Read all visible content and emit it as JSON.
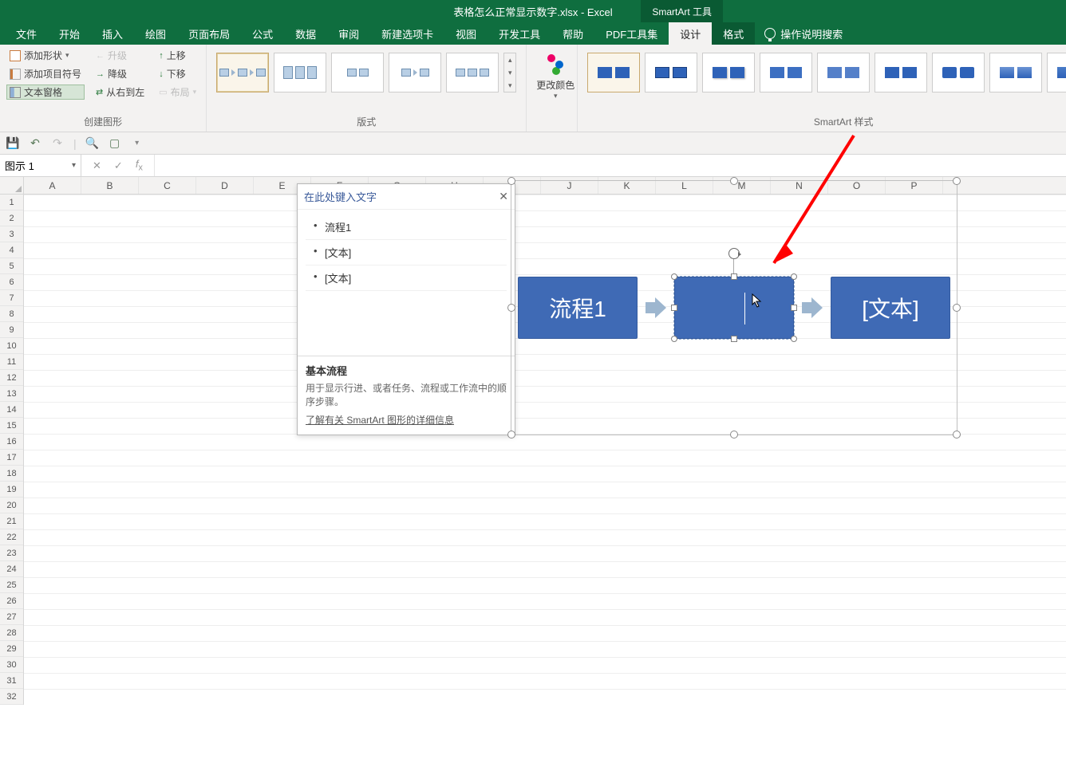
{
  "title": "表格怎么正常显示数字.xlsx - Excel",
  "context_tool_tab": "SmartArt 工具",
  "tabs": [
    "文件",
    "开始",
    "插入",
    "绘图",
    "页面布局",
    "公式",
    "数据",
    "审阅",
    "新建选项卡",
    "视图",
    "开发工具",
    "帮助",
    "PDF工具集",
    "设计",
    "格式"
  ],
  "active_tab_index": 13,
  "alt_tab_index": 14,
  "tell_me": "操作说明搜索",
  "ribbon": {
    "create_graphic": {
      "label": "创建图形",
      "add_shape": "添加形状",
      "add_bullet": "添加项目符号",
      "text_pane": "文本窗格",
      "promote": "升级",
      "demote": "降级",
      "rtl": "从右到左",
      "move_up": "上移",
      "move_down": "下移",
      "layout": "布局"
    },
    "layouts_label": "版式",
    "change_colors": "更改颜色",
    "styles_label": "SmartArt 样式"
  },
  "namebox": "图示 1",
  "columns": [
    "A",
    "B",
    "C",
    "D",
    "E",
    "F",
    "G",
    "H",
    "I",
    "J",
    "K",
    "L",
    "M",
    "N",
    "O",
    "P"
  ],
  "row_count": 32,
  "textpane": {
    "header": "在此处键入文字",
    "items": [
      "流程1",
      "[文本]",
      "[文本]"
    ],
    "footer_title": "基本流程",
    "footer_desc": "用于显示行进、或者任务、流程或工作流中的顺序步骤。",
    "footer_link": "了解有关 SmartArt 图形的详细信息"
  },
  "smartart": {
    "box1": "流程1",
    "box2": "",
    "box3": "[文本]"
  }
}
